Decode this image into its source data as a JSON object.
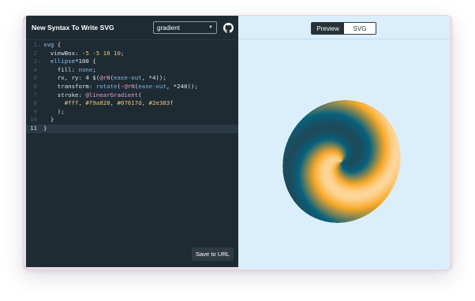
{
  "app": {
    "title": "New Syntax To Write SVG"
  },
  "header": {
    "selected_example": "gradient"
  },
  "editor": {
    "lines": [
      {
        "n": "1",
        "fold": "⌄",
        "parts": [
          [
            "k",
            "svg"
          ],
          [
            "w",
            " {"
          ]
        ]
      },
      {
        "n": "2",
        "fold": "",
        "parts": [
          [
            "w",
            "  viewBox: "
          ],
          [
            "n",
            "-5 -5 10 10"
          ],
          [
            "w",
            ";"
          ]
        ]
      },
      {
        "n": "3",
        "fold": "⌄",
        "parts": [
          [
            "w",
            "  "
          ],
          [
            "k",
            "ellipse"
          ],
          [
            "w",
            "*100 {"
          ]
        ]
      },
      {
        "n": "4",
        "fold": "",
        "parts": [
          [
            "w",
            "    fill: "
          ],
          [
            "c",
            "none"
          ],
          [
            "w",
            ";"
          ]
        ]
      },
      {
        "n": "5",
        "fold": "",
        "parts": [
          [
            "w",
            "    rx, ry: 4 $("
          ],
          [
            "f",
            "@rN"
          ],
          [
            "w",
            "("
          ],
          [
            "c",
            "ease-out"
          ],
          [
            "w",
            ", *4));"
          ]
        ]
      },
      {
        "n": "6",
        "fold": "",
        "parts": [
          [
            "w",
            "    transform: "
          ],
          [
            "c",
            "rotate"
          ],
          [
            "w",
            "(-"
          ],
          [
            "f",
            "@rN"
          ],
          [
            "w",
            "("
          ],
          [
            "c",
            "ease-out"
          ],
          [
            "w",
            ", *240));"
          ]
        ]
      },
      {
        "n": "7",
        "fold": "",
        "parts": [
          [
            "w",
            "    stroke: "
          ],
          [
            "f",
            "@linearGradient"
          ],
          [
            "w",
            "("
          ]
        ]
      },
      {
        "n": "8",
        "fold": "",
        "parts": [
          [
            "w",
            "      "
          ],
          [
            "n",
            "#fff, #f9a828, #07617d, #2e383f"
          ]
        ]
      },
      {
        "n": "9",
        "fold": "",
        "parts": [
          [
            "w",
            "    );"
          ]
        ]
      },
      {
        "n": "10",
        "fold": "",
        "parts": [
          [
            "w",
            "  }"
          ]
        ]
      },
      {
        "n": "11",
        "fold": "",
        "active": true,
        "parts": [
          [
            "w",
            "}"
          ]
        ]
      }
    ],
    "save_label": "Save to URL"
  },
  "preview": {
    "tabs": [
      {
        "label": "Preview",
        "active": true
      },
      {
        "label": "SVG",
        "active": false
      }
    ]
  },
  "gradient_colors": [
    "#fff",
    "#f9a828",
    "#07617d",
    "#2e383f"
  ]
}
